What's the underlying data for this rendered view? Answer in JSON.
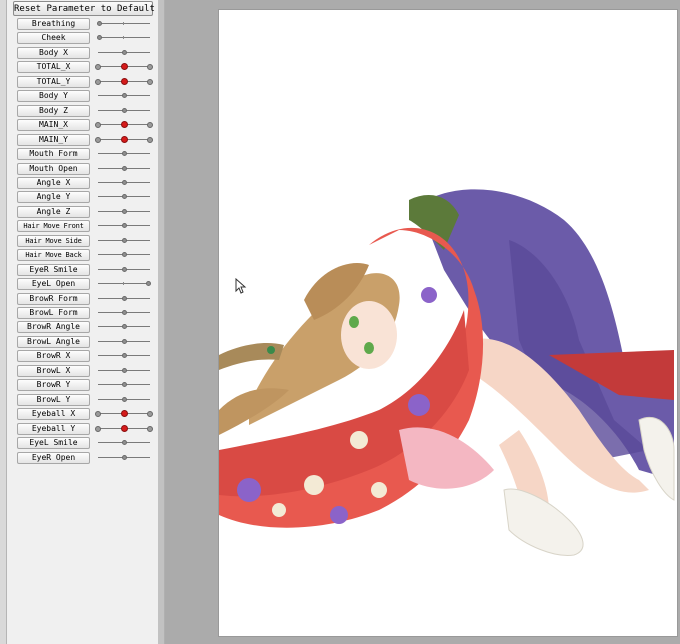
{
  "reset_button": "Reset Parameter to Default",
  "parameters": [
    {
      "label": "Breathing",
      "value": 0.0,
      "bipolar": false
    },
    {
      "label": "Cheek",
      "value": 0.0,
      "bipolar": false
    },
    {
      "label": "Body X",
      "value": 0.5,
      "bipolar": false
    },
    {
      "label": "TOTAL_X",
      "value": 0.5,
      "bipolar": true
    },
    {
      "label": "TOTAL_Y",
      "value": 0.5,
      "bipolar": true
    },
    {
      "label": "Body Y",
      "value": 0.5,
      "bipolar": false
    },
    {
      "label": "Body Z",
      "value": 0.5,
      "bipolar": false
    },
    {
      "label": "MAIN_X",
      "value": 0.5,
      "bipolar": true
    },
    {
      "label": "MAIN_Y",
      "value": 0.5,
      "bipolar": true
    },
    {
      "label": "Mouth Form",
      "value": 0.5,
      "bipolar": false
    },
    {
      "label": "Mouth Open",
      "value": 0.5,
      "bipolar": false
    },
    {
      "label": "Angle X",
      "value": 0.5,
      "bipolar": false
    },
    {
      "label": "Angle Y",
      "value": 0.5,
      "bipolar": false
    },
    {
      "label": "Angle Z",
      "value": 0.5,
      "bipolar": false
    },
    {
      "label": "Hair Move Front",
      "value": 0.5,
      "bipolar": false
    },
    {
      "label": "Hair Move Side",
      "value": 0.5,
      "bipolar": false
    },
    {
      "label": "Hair Move Back",
      "value": 0.5,
      "bipolar": false
    },
    {
      "label": "EyeR Smile",
      "value": 0.5,
      "bipolar": false
    },
    {
      "label": "EyeL Open",
      "value": 1.0,
      "bipolar": false
    },
    {
      "label": "BrowR Form",
      "value": 0.5,
      "bipolar": false
    },
    {
      "label": "BrowL Form",
      "value": 0.5,
      "bipolar": false
    },
    {
      "label": "BrowR Angle",
      "value": 0.5,
      "bipolar": false
    },
    {
      "label": "BrowL Angle",
      "value": 0.5,
      "bipolar": false
    },
    {
      "label": "BrowR X",
      "value": 0.5,
      "bipolar": false
    },
    {
      "label": "BrowL X",
      "value": 0.5,
      "bipolar": false
    },
    {
      "label": "BrowR Y",
      "value": 0.5,
      "bipolar": false
    },
    {
      "label": "BrowL Y",
      "value": 0.5,
      "bipolar": false
    },
    {
      "label": "Eyeball X",
      "value": 0.5,
      "bipolar": true
    },
    {
      "label": "Eyeball Y",
      "value": 0.5,
      "bipolar": true
    },
    {
      "label": "EyeL Smile",
      "value": 0.5,
      "bipolar": false
    },
    {
      "label": "EyeR Open",
      "value": 0.5,
      "bipolar": false
    }
  ],
  "colors": {
    "active_knob": "#d51a1a",
    "kimono": "#e8594f",
    "hair": "#c9a06a",
    "purple_cloth": "#6a5aa8"
  },
  "icons": {
    "cursor": "mouse-pointer-icon"
  }
}
